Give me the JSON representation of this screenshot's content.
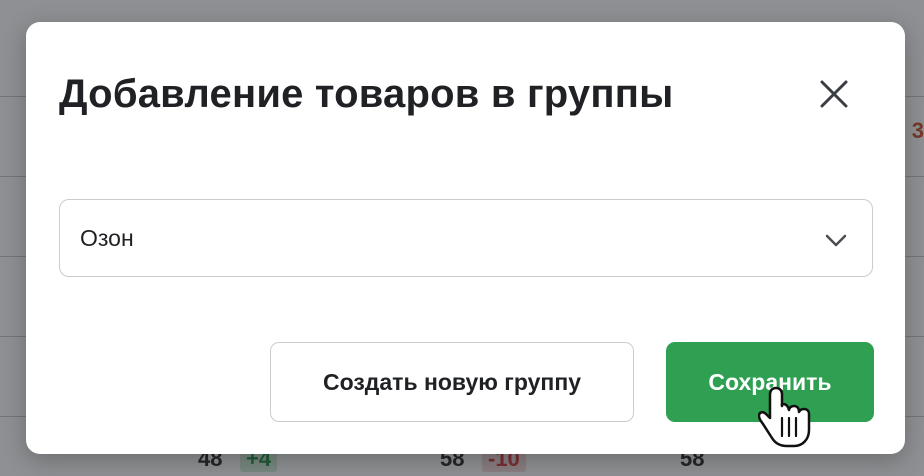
{
  "background_page": {
    "cells": [
      "48",
      "+4",
      "58",
      "-10",
      "58"
    ],
    "edge_glyph": "3"
  },
  "modal": {
    "title": "Добавление товаров в группы",
    "close_icon": "close-icon",
    "group_select": {
      "value": "Озон",
      "icon": "chevron-down-icon"
    },
    "buttons": {
      "create_group": "Создать новую группу",
      "save": "Сохранить"
    }
  },
  "colors": {
    "accent_green": "#2f9f52",
    "border": "#c9ccd0",
    "text": "#1f2124"
  },
  "cursor": "hand-pointer-icon"
}
